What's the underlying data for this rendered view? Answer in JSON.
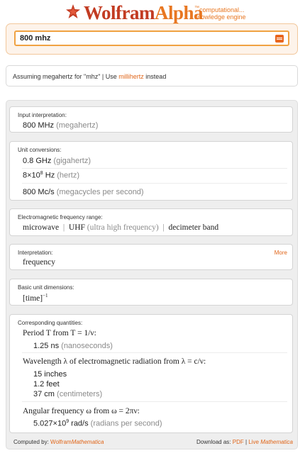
{
  "header": {
    "logo_wolfram": "Wolfram",
    "logo_alpha": "Alpha",
    "trademark": "™",
    "tagline_line1": "computational...",
    "tagline_line2": "knowledge engine"
  },
  "search": {
    "value": "800 mhz"
  },
  "assumption": {
    "prefix": "Assuming megahertz for \"mhz\" | Use ",
    "link": "millihertz",
    "suffix": " instead"
  },
  "pods": {
    "input": {
      "title": "Input interpretation:",
      "value": "800 MHz",
      "note": "(megahertz)"
    },
    "units": {
      "title": "Unit conversions:",
      "r1_value": "0.8 GHz",
      "r1_note": "(gigahertz)",
      "r2_mant": "8×10",
      "r2_exp": "8",
      "r2_unit": " Hz",
      "r2_note": "(hertz)",
      "r3_value": "800 Mc/s",
      "r3_note": "(megacycles per second)"
    },
    "em": {
      "title": "Electromagnetic frequency range:",
      "a": "microwave",
      "sep1": "|",
      "b": "UHF",
      "b_note": "(ultra high frequency)",
      "sep2": "|",
      "c": "decimeter band"
    },
    "interp": {
      "title": "Interpretation:",
      "more": "More",
      "value": "frequency"
    },
    "dims": {
      "title": "Basic unit dimensions:",
      "value": "[time]",
      "exp": "−1"
    },
    "quant": {
      "title": "Corresponding quantities:",
      "period_heading": "Period T from T = 1/ν:",
      "period_value": "1.25 ns",
      "period_note": "(nanoseconds)",
      "wave_heading": "Wavelength λ of electromagnetic radiation from λ = c/ν:",
      "wave_v1": "15 inches",
      "wave_v2": "1.2 feet",
      "wave_v3": "37 cm",
      "wave_v3_note": "(centimeters)",
      "ang_heading": "Angular frequency ω from ω = 2πν:",
      "ang_mant": "5.027×10",
      "ang_exp": "9",
      "ang_unit": " rad/s",
      "ang_note": "(radians per second)"
    }
  },
  "footer": {
    "computed_by": "Computed by:",
    "wolfram": "Wolfram",
    "mathematica": "Mathematica",
    "download": "Download as:",
    "pdf": "PDF",
    "bar": "|",
    "live": "Live",
    "live_math": "Mathematica"
  },
  "colors": {
    "brand_red": "#c23b22",
    "brand_orange": "#e87722",
    "link": "#e0661a"
  }
}
